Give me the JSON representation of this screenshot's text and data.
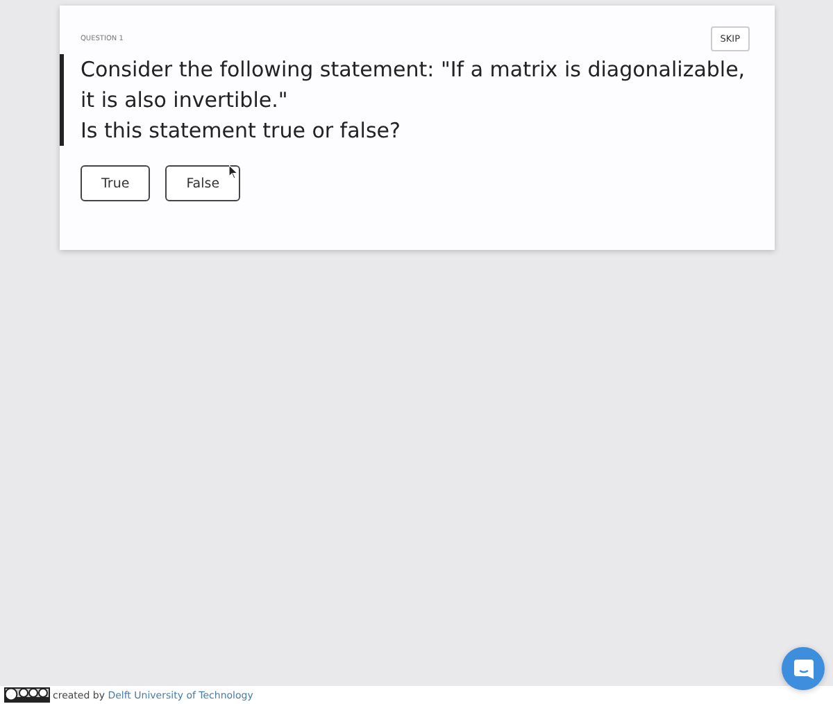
{
  "question": {
    "label": "QUESTION 1",
    "skip": "SKIP",
    "lines": [
      "Consider the following statement: \"If a matrix is diagonalizable, it is also invertible.\"",
      "Is this statement true or false?"
    ],
    "answers": [
      {
        "label": "True",
        "selected": false
      },
      {
        "label": "False",
        "selected": false
      }
    ]
  },
  "footer": {
    "text": "created by",
    "link": "Delft University of Technology"
  }
}
